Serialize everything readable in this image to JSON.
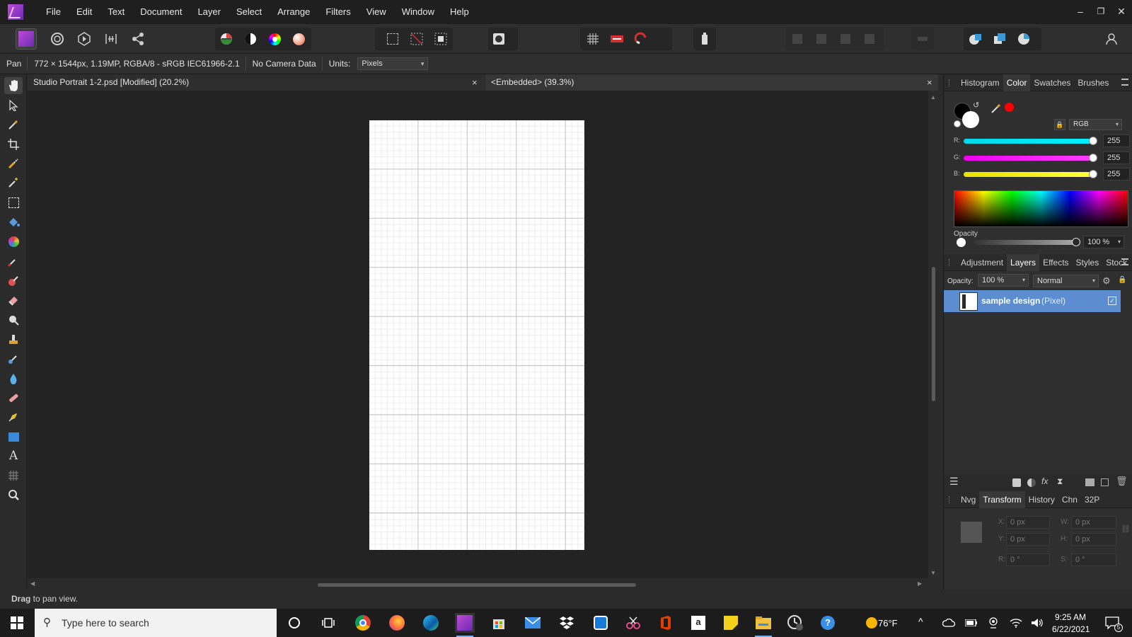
{
  "menu": {
    "items": [
      "File",
      "Edit",
      "Text",
      "Document",
      "Layer",
      "Select",
      "Arrange",
      "Filters",
      "View",
      "Window",
      "Help"
    ],
    "window_controls": [
      "–",
      "❐",
      "✕"
    ]
  },
  "context": {
    "tool_name": "Pan",
    "doc_info": "772 × 1544px, 1.19MP, RGBA/8 - sRGB IEC61966-2.1",
    "camera": "No Camera Data",
    "units_label": "Units:",
    "units_value": "Pixels"
  },
  "tabs": [
    {
      "title": "Studio Portrait 1-2.psd [Modified] (20.2%)",
      "close": "×"
    },
    {
      "title": "<Embedded> (39.3%)",
      "close": "×"
    }
  ],
  "color_panel": {
    "tabs": [
      "Histogram",
      "Color",
      "Swatches",
      "Brushes"
    ],
    "active_tab": "Color",
    "model": "RGB",
    "channels": [
      {
        "label": "R:",
        "value": "255"
      },
      {
        "label": "G:",
        "value": "255"
      },
      {
        "label": "B:",
        "value": "255"
      }
    ],
    "opacity_label": "Opacity",
    "opacity_value": "100 %",
    "accent_color": "#ff0000"
  },
  "layers_panel": {
    "tabs": [
      "Adjustment",
      "Layers",
      "Effects",
      "Styles",
      "Stock"
    ],
    "active_tab": "Layers",
    "opacity_label": "Opacity:",
    "opacity_value": "100 %",
    "blend_mode": "Normal",
    "layers": [
      {
        "name": "sample design",
        "type": "(Pixel)",
        "selected": true
      }
    ]
  },
  "transform_panel": {
    "tabs": [
      "Nvg",
      "Transform",
      "History",
      "Chn",
      "32P"
    ],
    "active_tab": "Transform",
    "fields": [
      {
        "label": "X:",
        "value": "0 px"
      },
      {
        "label": "W:",
        "value": "0 px"
      },
      {
        "label": "Y:",
        "value": "0 px"
      },
      {
        "label": "H:",
        "value": "0 px"
      },
      {
        "label": "R:",
        "value": "0 °"
      },
      {
        "label": "S:",
        "value": "0 °"
      }
    ]
  },
  "status": {
    "bold": "Drag",
    "rest": " to pan view."
  },
  "taskbar": {
    "search_placeholder": "Type here to search",
    "weather": "76°F",
    "time": "9:25 AM",
    "date": "6/22/2021",
    "notifications": "5"
  }
}
